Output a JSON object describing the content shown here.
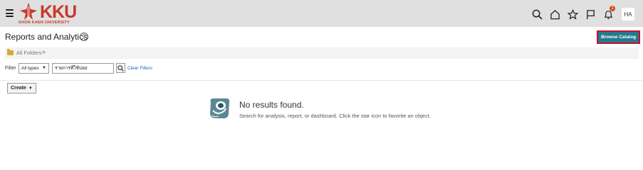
{
  "logo": {
    "text": "KKU",
    "subtitle": "KHON KAEN UNIVERSITY"
  },
  "header": {
    "icons": [
      "search-icon",
      "home-icon",
      "star-icon",
      "flag-icon",
      "bell-icon"
    ],
    "notification_count": "1",
    "user_initials": "HA"
  },
  "page": {
    "title": "Reports and Analytics",
    "help_symbol": "?",
    "browse_catalog_label": "Browse Catalog"
  },
  "breadcrumb": {
    "label": "All Folders",
    "chevron": "»"
  },
  "filter": {
    "label": "Filter",
    "type_value": "All types",
    "search_value": "รายการที่ใช้บ่อย",
    "clear_label": "Clear Filters"
  },
  "actions": {
    "create_label": "Create"
  },
  "empty_state": {
    "title": "No results found.",
    "message": "Search for analysis, report, or dashboard. Click the star icon to favorite an object."
  },
  "colors": {
    "topbar": "#e0e0e0",
    "brand_red": "#c43b2b",
    "browse_button": "#237a8e",
    "highlight_border": "#c8102e",
    "link": "#1a66b0"
  }
}
